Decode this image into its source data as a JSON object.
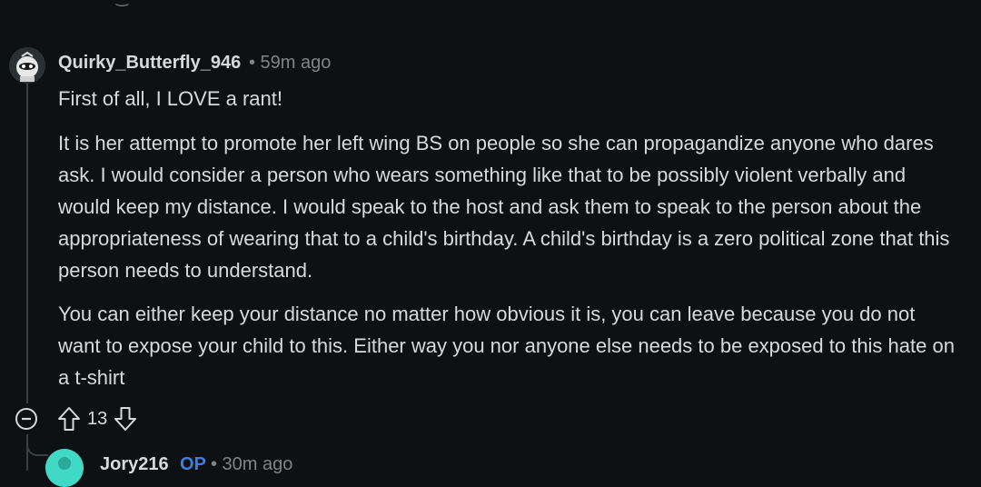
{
  "comment": {
    "author": "Quirky_Butterfly_946",
    "separator_time": "• 59m ago",
    "paragraphs": [
      "First of all, I LOVE a rant!",
      "It is her attempt to promote her left wing BS on people so she can propagandize anyone who dares ask. I would consider a person who wears something like that to be possibly violent verbally and would keep my distance. I would speak to the host and ask them to speak to the person about the appropriateness of wearing that to a child's birthday. A child's birthday is a zero political zone that this person needs to understand.",
      "You can either keep your distance no matter how obvious it is, you can leave because you do not want to expose your child to this. Either way you nor anyone else needs to be exposed to this hate on a t-shirt"
    ],
    "vote_count": "13",
    "icons": {
      "collapse": "minus-circle-icon",
      "upvote": "upvote-arrow-icon",
      "downvote": "downvote-arrow-icon",
      "avatar": "user-avatar"
    }
  },
  "reply": {
    "author": "Jory216",
    "badge": "OP",
    "separator_time": "• 30m ago"
  },
  "colors": {
    "background": "#0e1113",
    "text": "#d7dadc",
    "muted": "#818384",
    "op_badge": "#3d7fe0",
    "thread_line": "#3a3f42"
  }
}
